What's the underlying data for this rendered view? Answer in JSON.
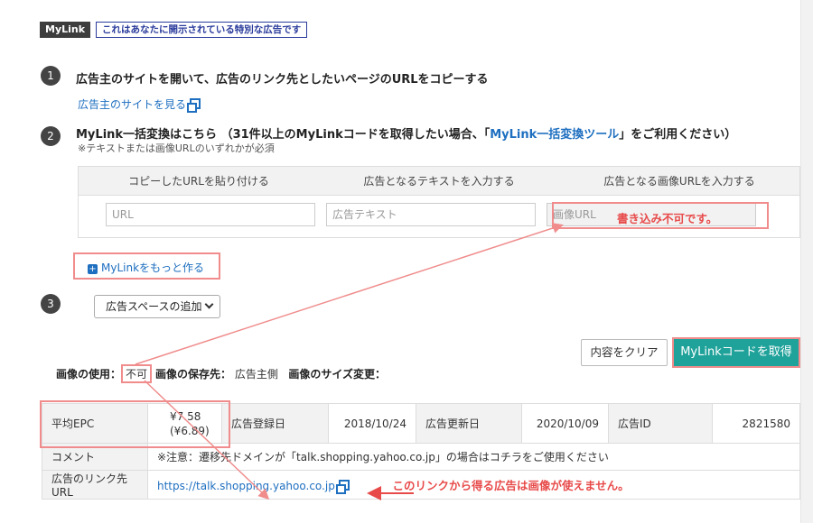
{
  "header": {
    "badge": "MyLink",
    "note": "これはあなたに開示されている特別な広告です"
  },
  "step1": {
    "number": "1",
    "text": "広告主のサイトを開いて、広告のリンク先としたいページのURLをコピーする",
    "link": "広告主のサイトを見る"
  },
  "step2": {
    "number": "2",
    "text_before": "MyLink一括変換はこちら （31件以上のMyLinkコードを取得したい場合、「",
    "tool_link": "MyLink一括変換ツール",
    "text_after": "」をご利用ください）",
    "note": "※テキストまたは画像URLのいずれかが必須"
  },
  "panel": {
    "headers": [
      "コピーしたURLを貼り付ける",
      "広告となるテキストを入力する",
      "広告となる画像URLを入力する"
    ],
    "url_placeholder": "URL",
    "text_placeholder": "広告テキスト",
    "image_placeholder": "画像URL",
    "image_warning": "書き込み不可です。"
  },
  "more_link": "MyLinkをもっと作る",
  "step3": {
    "number": "3",
    "select_value": "広告スペースの追加"
  },
  "buttons": {
    "clear": "内容をクリア",
    "get": "MyLinkコードを取得"
  },
  "usage": {
    "label_use": "画像の使用：",
    "value_use": "不可",
    "label_store": "画像の保存先：",
    "value_store": "広告主側",
    "label_resize": "画像のサイズ変更："
  },
  "table": {
    "epc_label": "平均EPC",
    "epc_value": "¥7.58",
    "epc_sub": "(¥6.89)",
    "reg_label": "広告登録日",
    "reg_value": "2018/10/24",
    "upd_label": "広告更新日",
    "upd_value": "2020/10/09",
    "id_label": "広告ID",
    "id_value": "2821580",
    "comment_label": "コメント",
    "comment_value": "※注意：遷移先ドメインが「talk.shopping.yahoo.co.jp」の場合はコチラをご使用ください",
    "dest_label": "広告のリンク先URL",
    "dest_value": "https://talk.shopping.yahoo.co.jp",
    "dest_annotation": "このリンクから得る広告は画像が使えません。"
  },
  "colors": {
    "accent": "#1fa29a",
    "annotation_red": "#e84a4a",
    "box_pink": "#f08c8c",
    "link_blue": "#1e6fc0"
  }
}
